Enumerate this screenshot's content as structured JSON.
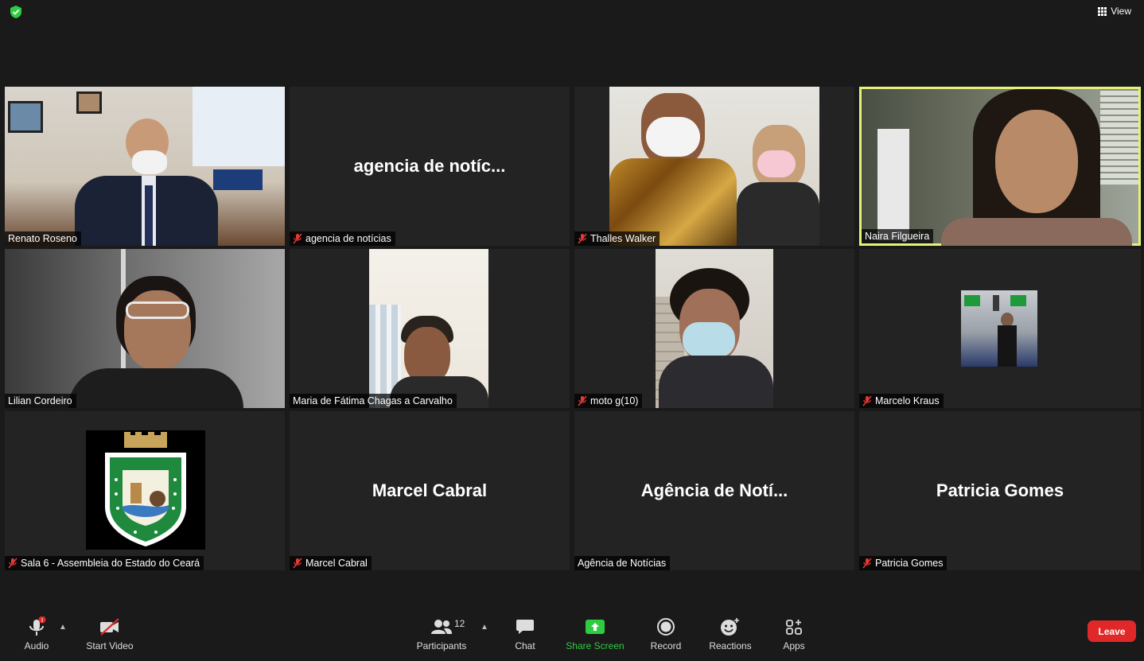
{
  "top": {
    "view_label": "View",
    "view_icon": "grid-icon",
    "security_icon": "shield-check-icon"
  },
  "tiles": [
    {
      "name": "Renato Roseno",
      "muted": false,
      "big": ""
    },
    {
      "name": "agencia de notícias",
      "muted": true,
      "big": "agencia de notíc..."
    },
    {
      "name": "Thalles Walker",
      "muted": true,
      "big": ""
    },
    {
      "name": "Naira Filgueira",
      "muted": false,
      "big": "",
      "active": true
    },
    {
      "name": "Lilian Cordeiro",
      "muted": false,
      "big": ""
    },
    {
      "name": "Maria de Fátima Chagas a Carvalho",
      "muted": false,
      "big": ""
    },
    {
      "name": "moto g(10)",
      "muted": true,
      "big": ""
    },
    {
      "name": "Marcelo Kraus",
      "muted": true,
      "big": ""
    },
    {
      "name": "Sala 6 - Assembleia do Estado do Ceará",
      "muted": true,
      "big": ""
    },
    {
      "name": "Marcel Cabral",
      "muted": true,
      "big": "Marcel Cabral"
    },
    {
      "name": "Agência de Notícias",
      "muted": false,
      "big": "Agência de Notí..."
    },
    {
      "name": "Patricia Gomes",
      "muted": true,
      "big": "Patricia Gomes"
    }
  ],
  "toolbar": {
    "audio": "Audio",
    "start_video": "Start Video",
    "participants": "Participants",
    "participants_count": "12",
    "chat": "Chat",
    "share_screen": "Share Screen",
    "record": "Record",
    "reactions": "Reactions",
    "apps": "Apps",
    "leave": "Leave"
  },
  "colors": {
    "active_border": "#e4f27a",
    "share_green": "#2ecc40",
    "leave_red": "#e02828",
    "mute_red": "#e53935"
  }
}
